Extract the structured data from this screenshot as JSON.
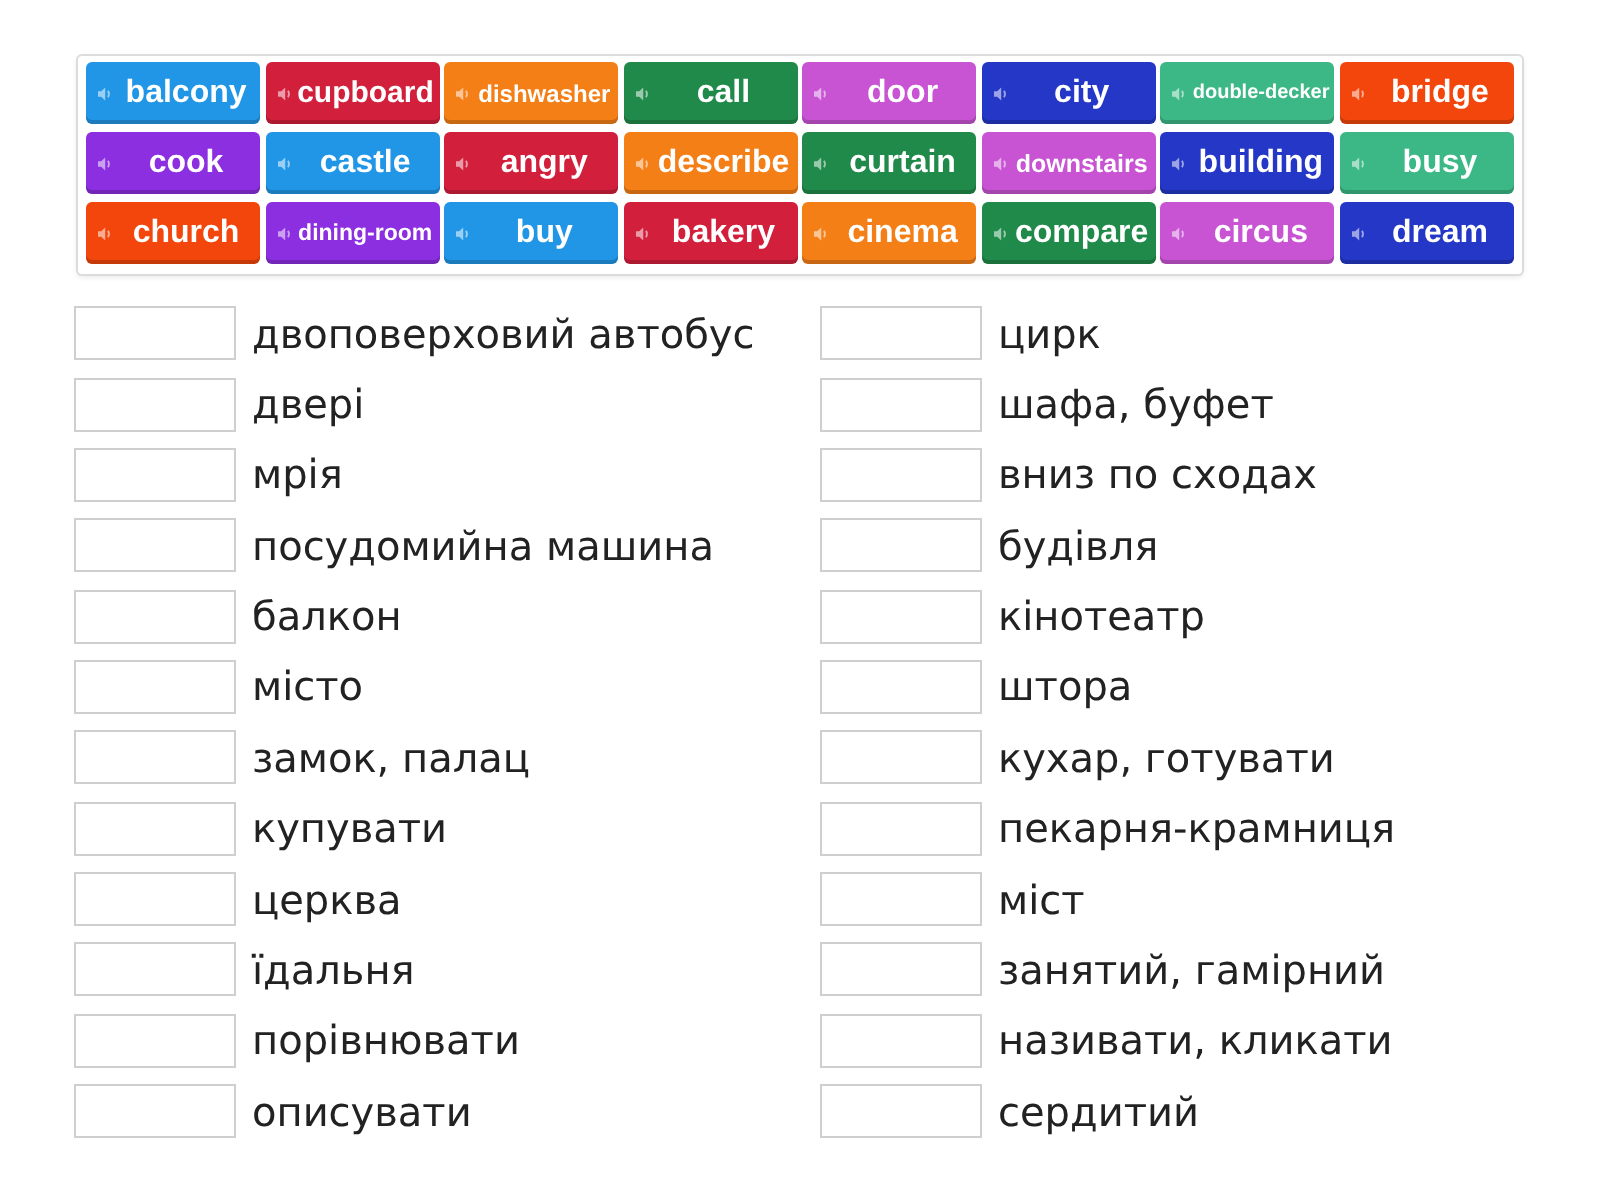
{
  "word_bank": {
    "tiles": [
      {
        "word": "balcony",
        "color": "#2196e6"
      },
      {
        "word": "cupboard",
        "color": "#d21f3c"
      },
      {
        "word": "dishwasher",
        "color": "#f57f17"
      },
      {
        "word": "call",
        "color": "#208a4a"
      },
      {
        "word": "door",
        "color": "#c854d4"
      },
      {
        "word": "city",
        "color": "#2437c6"
      },
      {
        "word": "double-decker",
        "color": "#3cb886"
      },
      {
        "word": "bridge",
        "color": "#f2460c"
      },
      {
        "word": "cook",
        "color": "#8b2fe0"
      },
      {
        "word": "castle",
        "color": "#2196e6"
      },
      {
        "word": "angry",
        "color": "#d21f3c"
      },
      {
        "word": "describe",
        "color": "#f57f17"
      },
      {
        "word": "curtain",
        "color": "#208a4a"
      },
      {
        "word": "downstairs",
        "color": "#c854d4"
      },
      {
        "word": "building",
        "color": "#2437c6"
      },
      {
        "word": "busy",
        "color": "#3cb886"
      },
      {
        "word": "church",
        "color": "#f2460c"
      },
      {
        "word": "dining-room",
        "color": "#8b2fe0"
      },
      {
        "word": "buy",
        "color": "#2196e6"
      },
      {
        "word": "bakery",
        "color": "#d21f3c"
      },
      {
        "word": "cinema",
        "color": "#f57f17"
      },
      {
        "word": "compare",
        "color": "#208a4a"
      },
      {
        "word": "circus",
        "color": "#c854d4"
      },
      {
        "word": "dream",
        "color": "#2437c6"
      }
    ]
  },
  "answer_columns": [
    {
      "definitions": [
        "двоповерховий автобус",
        "двері",
        "мрія",
        "посудомийна машина",
        "балкон",
        "місто",
        "замок, палац",
        "купувати",
        "церква",
        "їдальня",
        "порівнювати",
        "описувати"
      ]
    },
    {
      "definitions": [
        "цирк",
        "шафа, буфет",
        "вниз по сходах",
        "будівля",
        "кінотеатр",
        "штора",
        "кухар, готувати",
        "пекарня-крамниця",
        "міст",
        "занятий, гамірний",
        "називати, кликати",
        "сердитий"
      ]
    }
  ]
}
